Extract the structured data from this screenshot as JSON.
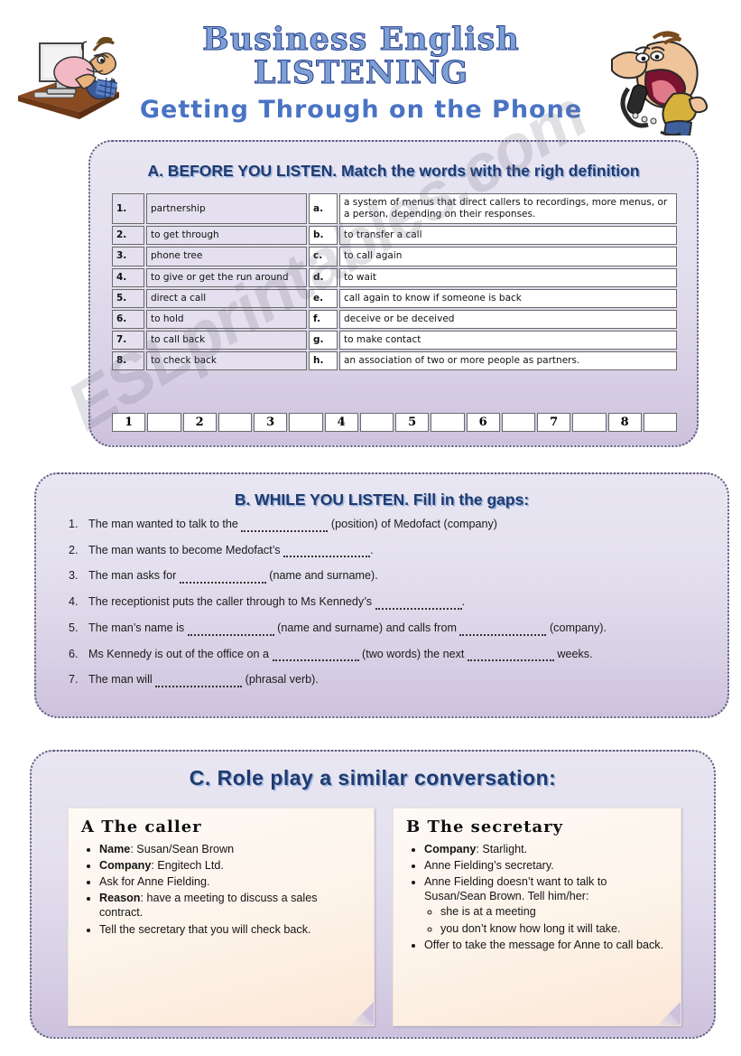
{
  "header": {
    "title_main": "Business English LISTENING",
    "title_sub": "Getting Through on the Phone",
    "clipart_left": "man-at-computer-with-headset-icon",
    "clipart_right": "shouting-man-with-telephone-icon"
  },
  "watermark": "ESLprintables.com",
  "sectionA": {
    "heading": "A. BEFORE YOU LISTEN. Match the words with the righ definition",
    "words": [
      {
        "num": "1.",
        "text": "partnership"
      },
      {
        "num": "2.",
        "text": "to get through"
      },
      {
        "num": "3.",
        "text": "phone tree"
      },
      {
        "num": "4.",
        "text": "to give or get the run around"
      },
      {
        "num": "5.",
        "text": "direct a call"
      },
      {
        "num": "6.",
        "text": "to hold"
      },
      {
        "num": "7.",
        "text": "to call back"
      },
      {
        "num": "8.",
        "text": "to check back"
      }
    ],
    "definitions": [
      {
        "letter": "a.",
        "text": "a system of menus that direct callers to recordings, more menus, or a person, depending on their responses."
      },
      {
        "letter": "b.",
        "text": "to transfer a call"
      },
      {
        "letter": "c.",
        "text": "to call again"
      },
      {
        "letter": "d.",
        "text": "to wait"
      },
      {
        "letter": "e.",
        "text": "call again to know if someone is back"
      },
      {
        "letter": "f.",
        "text": "deceive or be deceived"
      },
      {
        "letter": "g.",
        "text": "to make contact"
      },
      {
        "letter": "h.",
        "text": "an association of two or more people as partners."
      }
    ],
    "answer_row": [
      "1",
      "2",
      "3",
      "4",
      "5",
      "6",
      "7",
      "8"
    ]
  },
  "sectionB": {
    "heading": "B. WHILE YOU LISTEN. Fill in the gaps:",
    "items": [
      {
        "num": "1.",
        "pre": "The man wanted to talk to the ",
        "gap": "md",
        "post": " (position) of Medofact (company)"
      },
      {
        "num": "2.",
        "pre": "The man wants to become Medofact’s ",
        "gap": "md",
        "post": "."
      },
      {
        "num": "3.",
        "pre": "The man asks for ",
        "gap": "md",
        "post": " (name and surname)."
      },
      {
        "num": "4.",
        "pre": "The receptionist puts the caller through to Ms Kennedy’s ",
        "gap": "md",
        "post": "."
      },
      {
        "num": "5.",
        "pre": "The man’s name is ",
        "gap": "md",
        "post": " (name and surname) and calls from ",
        "gap2": "md",
        "post2": " (company)."
      },
      {
        "num": "6.",
        "pre": "Ms Kennedy is out of the office on a ",
        "gap": "md",
        "post": " (two words) the next ",
        "gap2": "md",
        "post2": " weeks."
      },
      {
        "num": "7.",
        "pre": "The man will ",
        "gap": "md",
        "post": " (phrasal verb)."
      }
    ]
  },
  "sectionC": {
    "heading": "C. Role play a similar conversation:",
    "card_a": {
      "title": "A The caller",
      "bullets": [
        {
          "label": "Name",
          "text": ": Susan/Sean Brown"
        },
        {
          "label": "Company",
          "text": ": Engitech Ltd."
        },
        {
          "label": "",
          "text": "Ask for Anne Fielding."
        },
        {
          "label": "Reason",
          "text": ": have a meeting to discuss a sales contract."
        },
        {
          "label": "",
          "text": "Tell the secretary that you will check back."
        }
      ]
    },
    "card_b": {
      "title": "B The secretary",
      "bullets": [
        {
          "label": "Company",
          "text": ": Starlight."
        },
        {
          "label": "",
          "text": "Anne Fielding’s secretary."
        },
        {
          "label": "",
          "text": "Anne Fielding doesn’t want to talk to Susan/Sean Brown. Tell him/her:",
          "sub": [
            "she is at a meeting",
            "you don’t know how long it will take."
          ]
        },
        {
          "label": "",
          "text": "Offer to take the message for Anne to call back."
        }
      ]
    }
  },
  "colors": {
    "heading_blue": "#1f3a6e",
    "heading_shadow": "#9bb4de",
    "panel_top": "#e9e6f2",
    "panel_bottom": "#cdc2dd",
    "card_bg": "#fdf3e9",
    "title_blue": "#4a73c4"
  }
}
